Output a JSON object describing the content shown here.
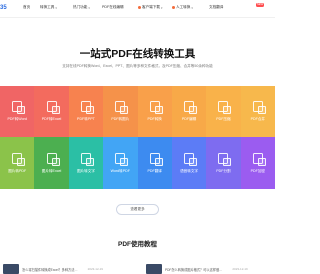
{
  "nav": {
    "logo": "35",
    "items": [
      {
        "label": "首页",
        "chevron": false
      },
      {
        "label": "转换工具",
        "chevron": true
      },
      {
        "label": "热门功能",
        "chevron": true
      },
      {
        "label": "PDF在线编辑",
        "chevron": false
      },
      {
        "label": "客户端下载",
        "chevron": true
      },
      {
        "label": "人工转换",
        "chevron": true
      },
      {
        "label": "文档翻译",
        "chevron": false
      }
    ],
    "badge": "NEW"
  },
  "hero": {
    "title": "一站式PDF在线转换工具",
    "subtitle": "支持在线PDF转换Word、Excel、PPT、图片等多种文件格式，及PDF压缩、合并等50余种功能"
  },
  "tiles": [
    {
      "label": "PDF转Word",
      "color": "#f06565"
    },
    {
      "label": "PDF转Excel",
      "color": "#f36b5e"
    },
    {
      "label": "PDF转PPT",
      "color": "#f7824f"
    },
    {
      "label": "PDF转图片",
      "color": "#f5924a"
    },
    {
      "label": "PDF转换",
      "color": "#f9a04a"
    },
    {
      "label": "PDF编辑",
      "color": "#f8a948"
    },
    {
      "label": "PDF压缩",
      "color": "#f9b24a"
    },
    {
      "label": "PDF合并",
      "color": "#f7b84c"
    },
    {
      "label": "图片转PDF",
      "color": "#8bc34a"
    },
    {
      "label": "图片转Excel",
      "color": "#4caf50"
    },
    {
      "label": "图片转文字",
      "color": "#2bbfa5"
    },
    {
      "label": "Word转PDF",
      "color": "#42a5f5"
    },
    {
      "label": "PDF翻译",
      "color": "#3d8bf0"
    },
    {
      "label": "语音转文字",
      "color": "#5c7cf6"
    },
    {
      "label": "PDF分割",
      "color": "#7e6cf0"
    },
    {
      "label": "PDF加密",
      "color": "#9b5cf0"
    }
  ],
  "more_button": "查看更多",
  "section_title": "PDF使用教程",
  "tutorials": [
    {
      "text": "怎么将扫描件转换成Excel？多种方法…",
      "date": "2023-12-19"
    },
    {
      "text": "PDF怎么转换成图片格式？可以这样做…",
      "date": "2023-12-19"
    }
  ]
}
